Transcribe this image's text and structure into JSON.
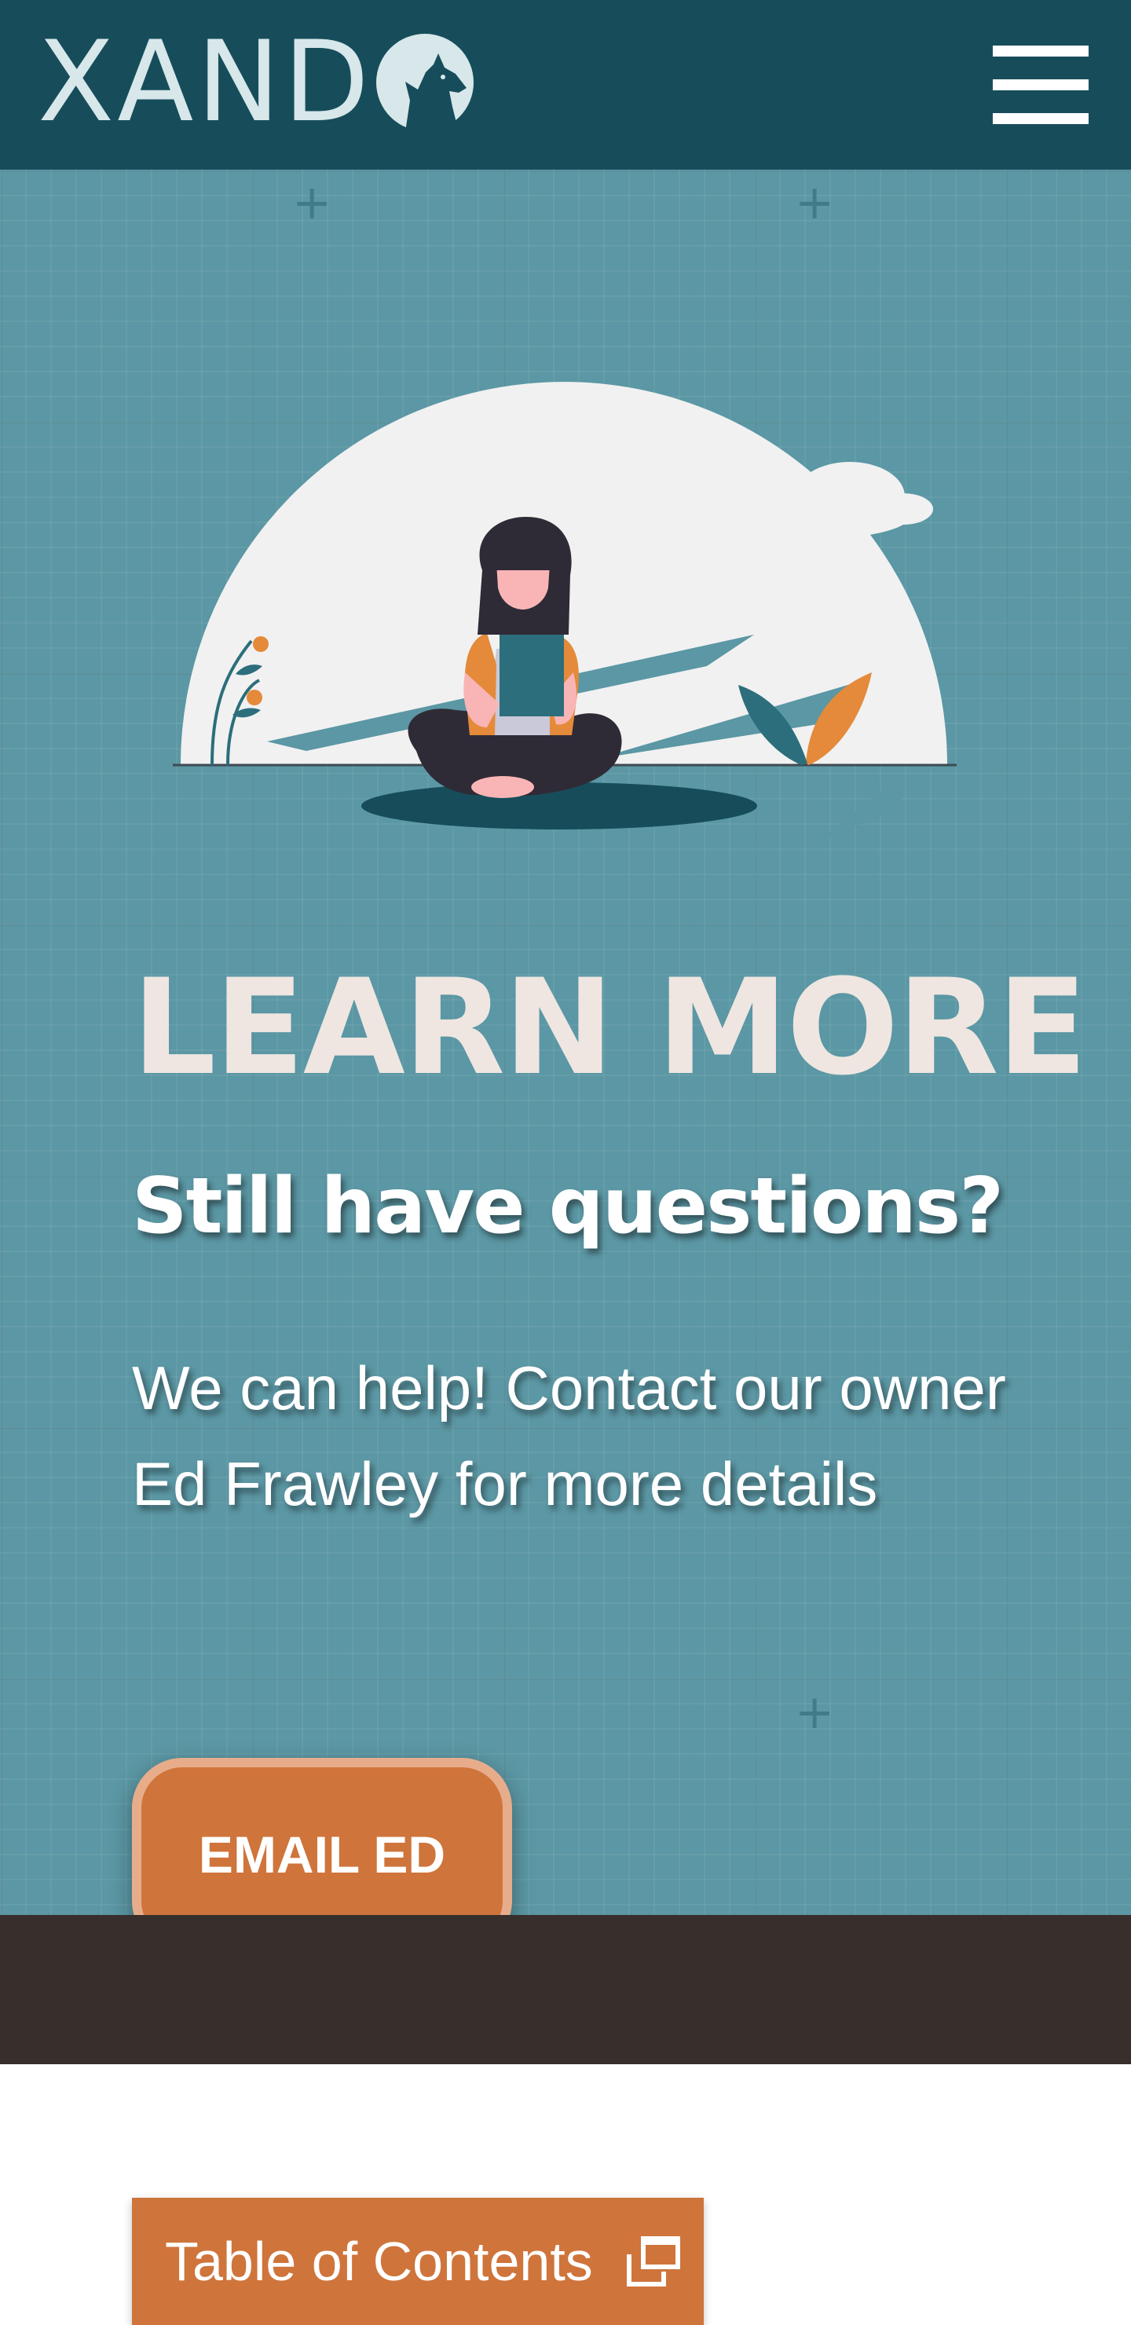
{
  "header": {
    "logo_text": "XAND",
    "logo_icon": "wolf-head-logo-icon",
    "menu_icon": "hamburger-menu-icon"
  },
  "hero": {
    "heading": "LEARN MORE",
    "subheading": "Still have questions?",
    "body": "We can help! Contact our owner Ed Frawley for more details",
    "button_label": "EMAIL ED",
    "illustration": "woman-reading-illustration"
  },
  "toc": {
    "label": "Table of Contents",
    "icon": "open-window-icon"
  },
  "colors": {
    "header_bg": "#174d5b",
    "hero_bg": "#5b97a4",
    "accent_orange": "#cf743b",
    "button_border": "#e7ad8b",
    "dark_band": "#382e2b",
    "logo_color": "#d7e7ea",
    "heading_color": "#efe6e1"
  }
}
